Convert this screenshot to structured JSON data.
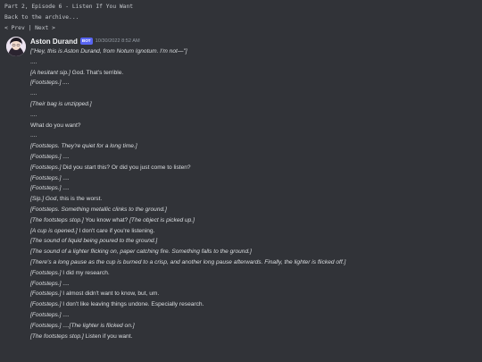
{
  "page_header": {
    "title": "Part 2, Episode 6 - Listen If You Want",
    "back_link": "Back to the archive...",
    "nav_prev": "< Prev",
    "nav_sep": " | ",
    "nav_next": "Next >"
  },
  "message": {
    "author": "Aston Durand",
    "bot_badge": "BOT",
    "timestamp": "10/30/2022 8:52 AM",
    "lines": [
      {
        "i": "[\"Hey, this is Aston Durand, from Notum Ignotum. I'm not—\"]",
        "t": ""
      },
      {
        "i": "",
        "t": "...."
      },
      {
        "i": "[A hesitant sip.]",
        "t": " God. That's terrible."
      },
      {
        "i": "[Footsteps.] ....",
        "t": ""
      },
      {
        "i": "",
        "t": "...."
      },
      {
        "i": "[Their bag is unzipped.]",
        "t": ""
      },
      {
        "i": "",
        "t": "...."
      },
      {
        "i": "",
        "t": "What do you want?"
      },
      {
        "i": "",
        "t": "...."
      },
      {
        "i": "[Footsteps. They're quiet for a long time.]",
        "t": ""
      },
      {
        "i": "[Footsteps.]",
        "t": " ...."
      },
      {
        "i": "[Footsteps.]",
        "t": " Did you start this? Or did you just come to listen?"
      },
      {
        "i": "[Footsteps.]",
        "t": " ...."
      },
      {
        "i": "[Footsteps.]",
        "t": " ...."
      },
      {
        "i": "[Sip.] God",
        "t": ", this is the worst."
      },
      {
        "i": "[Footsteps. Something metallic clinks to the ground.]",
        "t": ""
      },
      {
        "i": "[The footsteps stop.]",
        "t": " You know what? ",
        "i2": "[The object is picked up.]"
      },
      {
        "i": "[A cup is opened.]",
        "t": " I don't care if you're listening."
      },
      {
        "i": "[The sound of liquid being poured to the ground.]",
        "t": ""
      },
      {
        "i": "[The sound of a lighter flicking on, paper catching fire. Something falls to the ground.]",
        "t": ""
      },
      {
        "i": "[There's a long pause as the cup is burned to a crisp, and another long pause afterwards. Finally, the lighter is flicked off.]",
        "t": ""
      },
      {
        "i": "[Footsteps.]",
        "t": " I did my research."
      },
      {
        "i": "[Footsteps.]",
        "t": " ...."
      },
      {
        "i": "[Footsteps.]",
        "t": " I almost didn't want to know, but, um."
      },
      {
        "i": "[Footsteps.]",
        "t": " I don't like leaving things undone. Especially research."
      },
      {
        "i": "[Footsteps.]",
        "t": " ...."
      },
      {
        "i": "[Footsteps.]",
        "t": " ....",
        "i2": "[The lighter is flicked on.]"
      },
      {
        "i": "[The footsteps stop.]",
        "t": " Listen if you want."
      }
    ]
  },
  "colors": {
    "background": "#313338",
    "text": "#dbdee1",
    "bot_badge": "#5865f2",
    "timestamp": "#949ba4"
  }
}
